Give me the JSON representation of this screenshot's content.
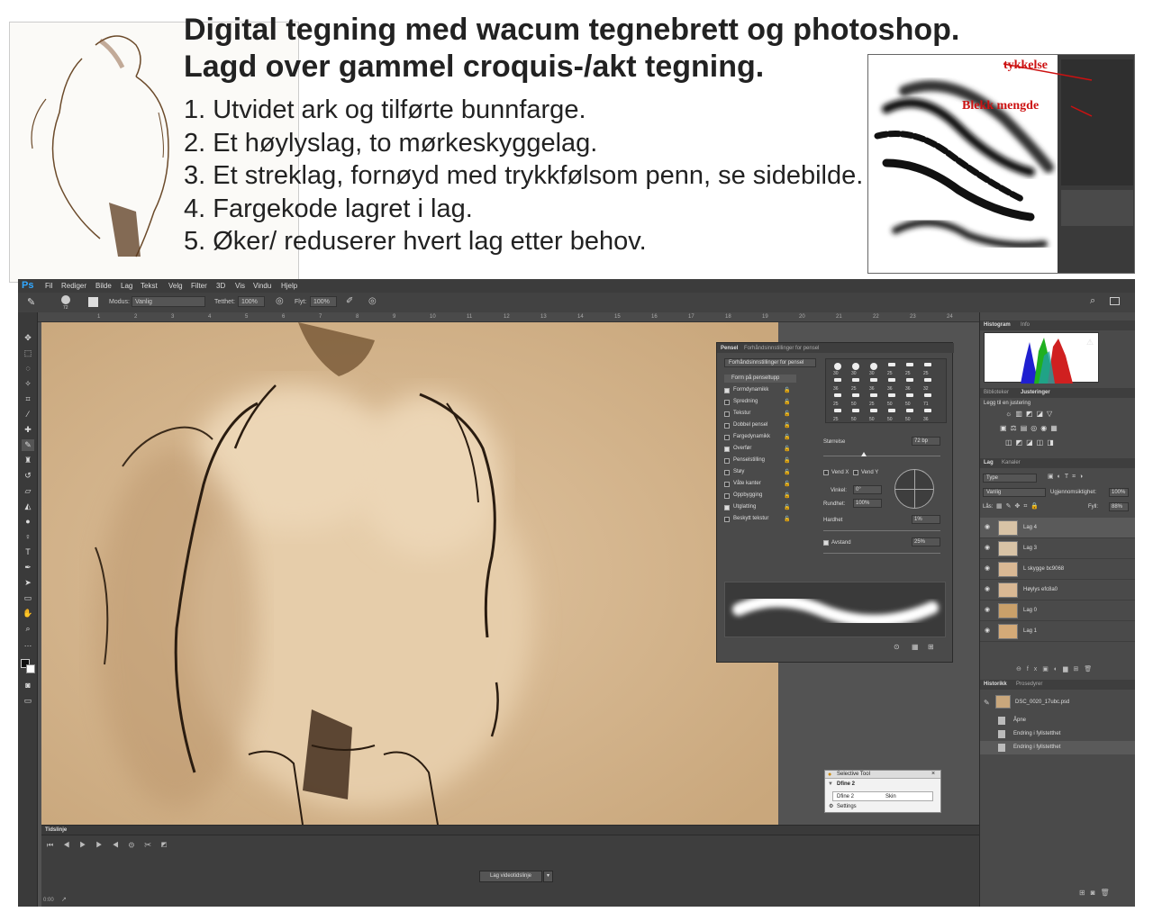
{
  "header": {
    "title_line1": "Digital tegning med wacum tegnebrett og photoshop.",
    "title_line2": "Lagd over gammel croquis-/akt tegning.",
    "steps": [
      "1. Utvidet ark og tilførte bunnfarge.",
      "2. Et høylyslag, to mørkeskyggelag.",
      "3. Et streklag, fornøyd med trykkfølsom penn, se sidebilde.",
      "4. Fargekode lagret i lag.",
      "5. Øker/ reduserer hvert lag etter behov."
    ]
  },
  "brush_inset": {
    "label_thickness": "tykkelse",
    "label_ink": "Blekk mengde",
    "annotation_color": "#cc1111"
  },
  "photoshop": {
    "logo": "Ps",
    "menu": [
      "Fil",
      "Rediger",
      "Bilde",
      "Lag",
      "Tekst",
      "Velg",
      "Filter",
      "3D",
      "Vis",
      "Vindu",
      "Hjelp"
    ],
    "options": {
      "brush_size": "72",
      "mode_label": "Modus:",
      "mode_value": "Vanlig",
      "opacity_label": "Tetthet:",
      "opacity_value": "100%",
      "flow_label": "Flyt:",
      "flow_value": "100%"
    },
    "ruler_ticks": [
      "1",
      "2",
      "3",
      "4",
      "5",
      "6",
      "7",
      "8",
      "9",
      "10",
      "11",
      "12",
      "13",
      "14",
      "15",
      "16",
      "17",
      "18",
      "19",
      "20",
      "21",
      "22",
      "23",
      "24"
    ],
    "brush_panel": {
      "tab1": "Pensel",
      "tab2": "Forhåndsinnstillinger for pensel",
      "presets_button": "Forhåndsinnstillinger for pensel",
      "section_title": "Form på penseltupp",
      "items": [
        {
          "label": "Formdynamikk",
          "checked": true
        },
        {
          "label": "Spredning",
          "checked": false
        },
        {
          "label": "Tekstur",
          "checked": false
        },
        {
          "label": "Dobbel pensel",
          "checked": false
        },
        {
          "label": "Fargedynamikk",
          "checked": false
        },
        {
          "label": "Overfør",
          "checked": true
        },
        {
          "label": "Penselstilling",
          "checked": false
        },
        {
          "label": "Støy",
          "checked": false
        },
        {
          "label": "Våte kanter",
          "checked": false
        },
        {
          "label": "Oppbygging",
          "checked": false
        },
        {
          "label": "Utglatting",
          "checked": true
        },
        {
          "label": "Beskytt tekstur",
          "checked": false
        }
      ],
      "size_row1": [
        "30",
        "30",
        "30",
        "25",
        "25",
        "25"
      ],
      "size_row2": [
        "36",
        "25",
        "36",
        "36",
        "36",
        "32"
      ],
      "size_row3": [
        "25",
        "50",
        "25",
        "50",
        "50",
        "71"
      ],
      "size_row4": [
        "25",
        "50",
        "50",
        "50",
        "50",
        "36"
      ],
      "size_label": "Størrelse",
      "size_value": "72 bp",
      "flip_x": "Vend X",
      "flip_y": "Vend Y",
      "angle_label": "Vinkel:",
      "angle_value": "0°",
      "roundness_label": "Rundhet:",
      "roundness_value": "100%",
      "hardness_label": "Hardhet",
      "hardness_value": "1%",
      "spacing_label": "Avstand",
      "spacing_value": "25%"
    },
    "histogram": {
      "tab1": "Histogram",
      "tab2": "Info"
    },
    "adjustments": {
      "tab1": "Biblioteker",
      "tab2": "Justeringer",
      "hint": "Legg til en justering"
    },
    "layers_panel": {
      "tab1": "Lag",
      "tab2": "Kanaler",
      "filter": "Type",
      "blend": "Vanlig",
      "opacity_label": "Ugjennomsiktighet:",
      "opacity_value": "100%",
      "lock_label": "Lås:",
      "fill_label": "Fyll:",
      "fill_value": "88%",
      "layers": [
        {
          "name": "Lag 4",
          "selected": true
        },
        {
          "name": "Lag 3",
          "selected": false
        },
        {
          "name": "L skygge bc9068",
          "selected": false
        },
        {
          "name": "Høylys efc8a0",
          "selected": false
        },
        {
          "name": "Lag 0",
          "selected": false
        },
        {
          "name": "Lag 1",
          "selected": false
        }
      ]
    },
    "history": {
      "tab1": "Historikk",
      "tab2": "Prosedyrer",
      "snapshot": "DSC_0020_17ubc.psd",
      "items": [
        "Åpne",
        "Endring i fyllstetthet",
        "Endring i fyllstetthet"
      ]
    },
    "timeline": {
      "title": "Tidslinje",
      "create_button": "Lag videotidslinje",
      "frame": "0:00"
    },
    "selective_tool": {
      "title": "Selective Tool",
      "item": "Dfine 2",
      "sub1": "Dfine 2",
      "sub2": "Skin",
      "settings": "Settings"
    }
  }
}
